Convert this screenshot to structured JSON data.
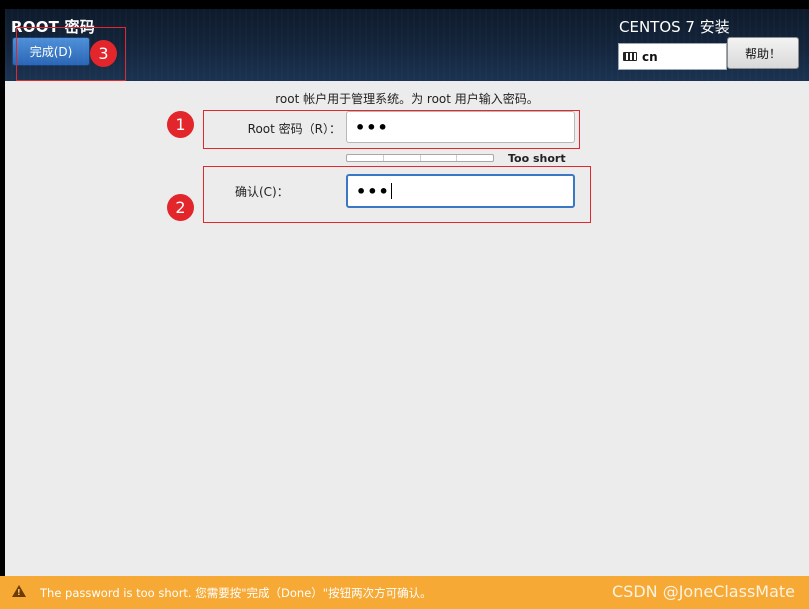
{
  "header": {
    "title": "ROOT 密码",
    "done_button": "完成(D)",
    "product_title": "CENTOS 7 安装",
    "keyboard_layout": "cn",
    "help_button": "帮助！"
  },
  "form": {
    "instruction": "root 帐户用于管理系统。为 root 用户输入密码。",
    "root_password_label": "Root 密码（R）：",
    "root_password_value": "•••",
    "strength_label": "Too short",
    "strength_level": 0,
    "confirm_label": "确认(C)：",
    "confirm_value": "•••"
  },
  "annotations": {
    "badge_1": "1",
    "badge_2": "2",
    "badge_3": "3",
    "color": "#e3262b"
  },
  "status_bar": {
    "message": "The password is too short. 您需要按\"完成（Done）\"按钮两次方可确认。",
    "watermark": "CSDN @JoneClassMate",
    "color": "#f6a935"
  }
}
